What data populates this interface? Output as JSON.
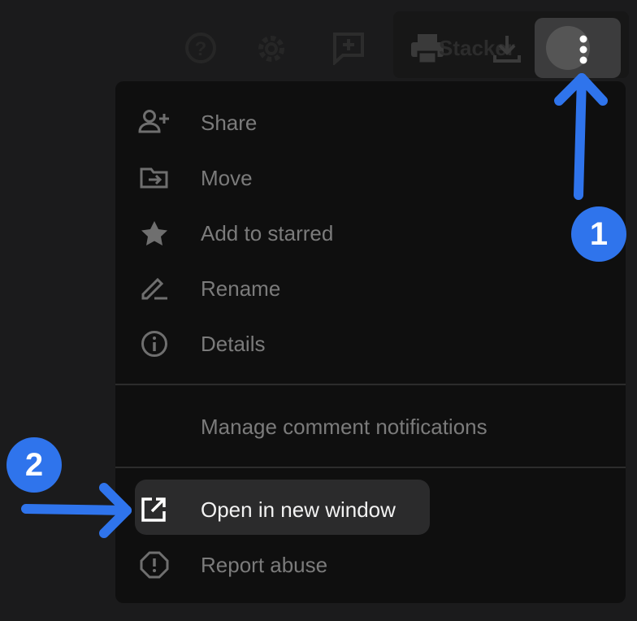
{
  "toolbar": {
    "help_icon": "help-icon",
    "settings_icon": "gear-icon",
    "add_comment_icon": "add-comment-icon",
    "print_icon": "print-icon",
    "stacker_label": "Stacker",
    "download_icon": "download-icon",
    "more_icon": "more-vert-icon"
  },
  "menu": {
    "items": [
      {
        "label": "Share",
        "icon": "person-add-icon"
      },
      {
        "label": "Move",
        "icon": "drive-file-move-icon"
      },
      {
        "label": "Add to starred",
        "icon": "star-icon"
      },
      {
        "label": "Rename",
        "icon": "edit-icon"
      },
      {
        "label": "Details",
        "icon": "info-icon"
      },
      {
        "label": "Manage comment notifications",
        "icon": ""
      },
      {
        "label": "Open in new window",
        "icon": "open-in-new-icon"
      },
      {
        "label": "Report abuse",
        "icon": "report-icon"
      }
    ]
  },
  "annotations": {
    "step1": "1",
    "step2": "2",
    "color": "#2f74ec"
  }
}
